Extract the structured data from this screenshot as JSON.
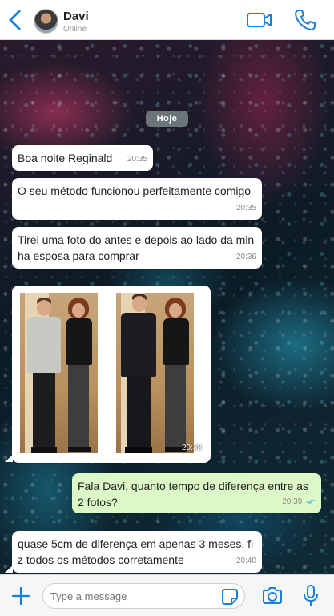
{
  "header": {
    "contact_name": "Davi",
    "contact_status": "Online",
    "back_icon": "chevron-left-icon",
    "video_icon": "video-camera-icon",
    "call_icon": "phone-icon",
    "accent_color": "#1a7fd6"
  },
  "chat": {
    "date_label": "Hoje",
    "messages": [
      {
        "direction": "in",
        "text": "Boa noite Reginald",
        "time": "20:35"
      },
      {
        "direction": "in",
        "text": "O seu método funcionou perfeitamente comigo",
        "time": "20:35"
      },
      {
        "direction": "in",
        "text": "Tirei uma foto do antes e depois ao lado da minha esposa para comprar",
        "time": "20:36"
      },
      {
        "direction": "in",
        "type": "image",
        "time": "20:38"
      },
      {
        "direction": "out",
        "text": "Fala Davi, quanto tempo de diferença entre as 2 fotos?",
        "time": "20:39",
        "status": "read"
      },
      {
        "direction": "in",
        "text": "quase 5cm de diferença em apenas 3 meses, fiz todos os métodos corretamente",
        "time": "20:40"
      }
    ],
    "incoming_bubble_color": "#ffffff",
    "outgoing_bubble_color": "#dcf8c6",
    "read_check_color": "#4fb3e8"
  },
  "input_bar": {
    "placeholder": "Type a message",
    "value": "",
    "plus_icon": "plus-icon",
    "sticker_icon": "sticker-icon",
    "camera_icon": "camera-icon",
    "mic_icon": "microphone-icon"
  }
}
